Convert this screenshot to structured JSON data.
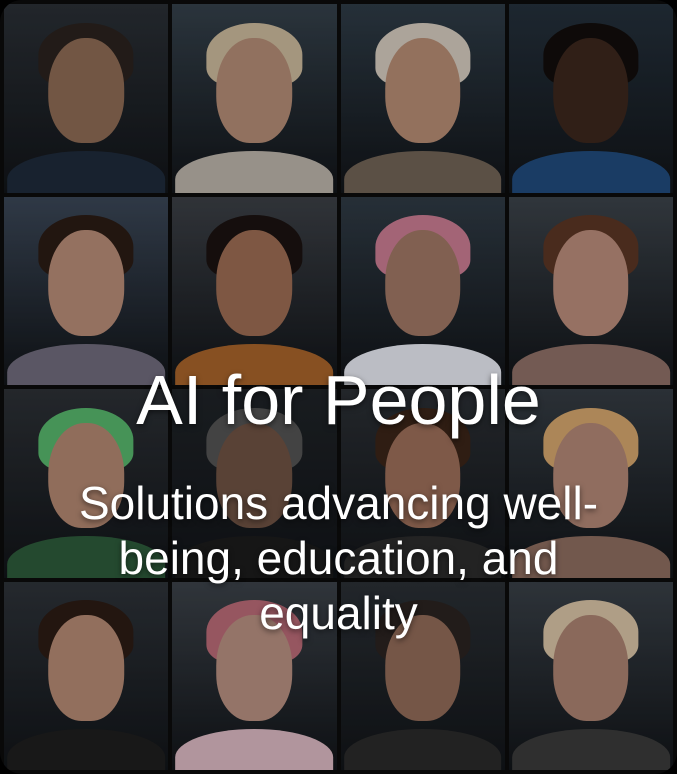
{
  "hero": {
    "title": "AI for People",
    "subtitle": "Solutions advancing well-being, education, and equality"
  },
  "portraits": [
    {
      "name": "portrait-man-dark-shirt",
      "bg": "#2a2f35",
      "skin": "#8b6a54",
      "hair": "#2a221e",
      "top": "#1e2a3a"
    },
    {
      "name": "portrait-woman-blonde-short-hair",
      "bg": "#34404a",
      "skin": "#b18a74",
      "hair": "#c9b79a",
      "top": "#b9b1a8"
    },
    {
      "name": "portrait-older-man-mustache",
      "bg": "#2e3b46",
      "skin": "#b48a72",
      "hair": "#d2c8bc",
      "top": "#6f6255"
    },
    {
      "name": "portrait-young-man",
      "bg": "#24303b",
      "skin": "#3b261d",
      "hair": "#120d0b",
      "top": "#204a7a"
    },
    {
      "name": "portrait-woman-dark-hair",
      "bg": "#3a4656",
      "skin": "#b58a76",
      "hair": "#2a1b14",
      "top": "#6e6a7a"
    },
    {
      "name": "portrait-woman-long-dark-hair",
      "bg": "#3b3f45",
      "skin": "#9a6b52",
      "hair": "#1a1210",
      "top": "#a5622a"
    },
    {
      "name": "portrait-man-pink-hair",
      "bg": "#2f3a44",
      "skin": "#9e7663",
      "hair": "#c77b91",
      "top": "#e5e7ef"
    },
    {
      "name": "portrait-woman-wavy-brown-hair",
      "bg": "#3b4249",
      "skin": "#b88a79",
      "hair": "#5a3524",
      "top": "#8d6e66"
    },
    {
      "name": "portrait-man-green-hair",
      "bg": "#2c3035",
      "skin": "#b08570",
      "hair": "#56b46b",
      "top": "#2d5a3a"
    },
    {
      "name": "portrait-man-gray-hair",
      "bg": "#1f2327",
      "skin": "#6d5143",
      "hair": "#525252",
      "top": "#1b1b1b"
    },
    {
      "name": "portrait-woman-short-brown-hair",
      "bg": "#2b2f34",
      "skin": "#9a6d58",
      "hair": "#3a2418",
      "top": "#2b2b2b"
    },
    {
      "name": "portrait-woman-curly-blonde-hair",
      "bg": "#343b42",
      "skin": "#b08574",
      "hair": "#d2a46c",
      "top": "#8b6c5e"
    },
    {
      "name": "portrait-woman-smiling-dark-hair",
      "bg": "#2d3238",
      "skin": "#b28872",
      "hair": "#2b1b14",
      "top": "#1e1e1e"
    },
    {
      "name": "portrait-woman-pink-hair",
      "bg": "#3b4148",
      "skin": "#b58e7f",
      "hair": "#b86a76",
      "top": "#d8b6c0"
    },
    {
      "name": "portrait-man-short-hair",
      "bg": "#2a2f34",
      "skin": "#8f6a57",
      "hair": "#2a2320",
      "top": "#2a2a2a"
    },
    {
      "name": "portrait-person-long-blonde-hair",
      "bg": "#383f46",
      "skin": "#a98170",
      "hair": "#d6c1a4",
      "top": "#3a3a3a"
    }
  ]
}
